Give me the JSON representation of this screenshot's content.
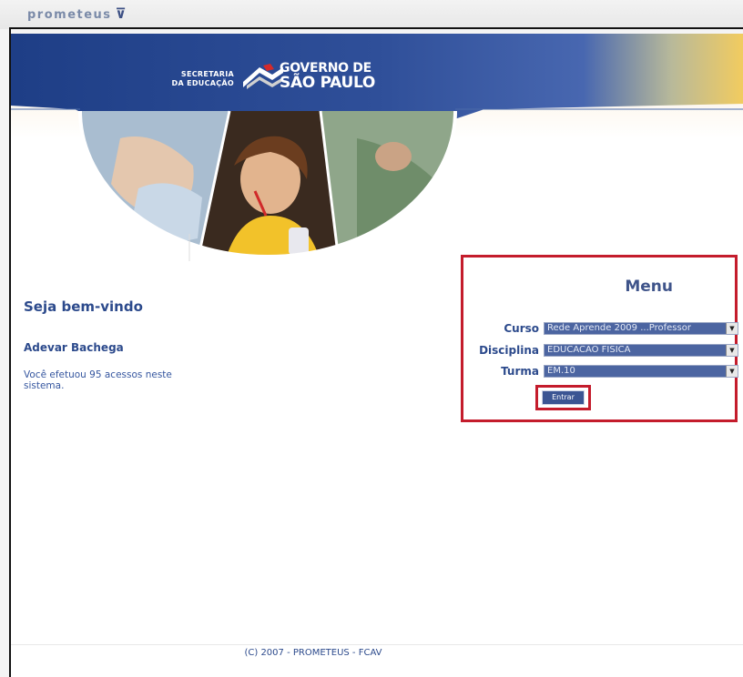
{
  "app": {
    "brand": "prometeus"
  },
  "header": {
    "logo_secretaria": "SECRETARIA\nDA EDUCAÇÃO",
    "logo_governo_line1": "GOVERNO DE",
    "logo_governo_line2": "SÃO PAULO"
  },
  "welcome": {
    "greeting": "Seja bem-vindo",
    "user_name": "Adevar Bachega",
    "access_info": "Você efetuou 95 acessos neste sistema."
  },
  "menu": {
    "title": "Menu",
    "curso_label": "Curso",
    "curso_value": "Rede Aprende 2009 ...Professor",
    "disciplina_label": "Disciplina",
    "disciplina_value": "EDUCACAO FISICA",
    "turma_label": "Turma",
    "turma_value": "EM.10",
    "submit_label": "Entrar"
  },
  "footer": {
    "copyright": "(C) 2007 - PROMETEUS - FCAV"
  },
  "colors": {
    "banner_blue": "#2d4c93",
    "accent_gold": "#f3cc5e",
    "text_blue": "#2c4a8c",
    "highlight_red": "#c41c2c"
  }
}
